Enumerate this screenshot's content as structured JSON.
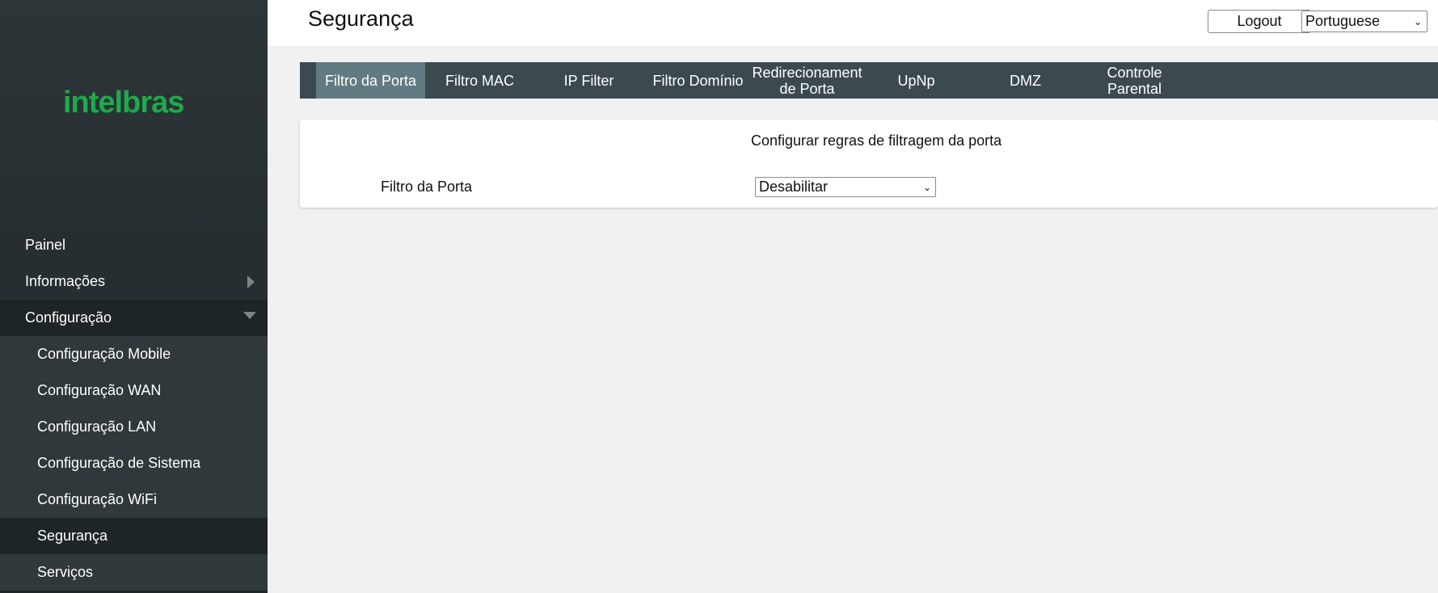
{
  "brand": {
    "logo_text": "intelbras",
    "accent_color": "#1eaa4b"
  },
  "header": {
    "title": "Segurança",
    "logout_label": "Logout",
    "language_selected": "Portuguese"
  },
  "sidebar": {
    "items": [
      {
        "label": "Painel"
      },
      {
        "label": "Informações"
      },
      {
        "label": "Configuração"
      }
    ],
    "sub_items": [
      {
        "label": "Configuração Mobile"
      },
      {
        "label": "Configuração WAN"
      },
      {
        "label": "Configuração LAN"
      },
      {
        "label": "Configuração de Sistema"
      },
      {
        "label": "Configuração WiFi"
      },
      {
        "label": "Segurança"
      },
      {
        "label": "Serviços"
      }
    ]
  },
  "tabs": [
    {
      "label": "Filtro da Porta"
    },
    {
      "label": "Filtro MAC"
    },
    {
      "label": "IP Filter"
    },
    {
      "label": "Filtro Domínio"
    },
    {
      "label": "Redirecionament de Porta"
    },
    {
      "label": "UpNp"
    },
    {
      "label": "DMZ"
    },
    {
      "label": "Controle Parental"
    }
  ],
  "card": {
    "title": "Configurar regras de filtragem da porta",
    "field_label": "Filtro da Porta",
    "field_value": "Desabilitar"
  }
}
